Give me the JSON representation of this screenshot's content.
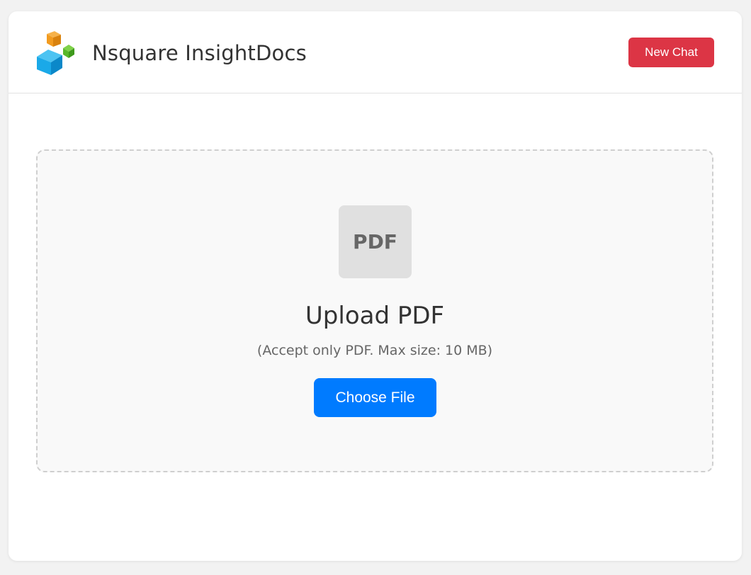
{
  "header": {
    "logo_icon": "stacked-cubes-logo-icon",
    "title": "Nsquare InsightDocs",
    "new_chat_label": "New Chat"
  },
  "upload": {
    "file_icon": "pdf-file-icon",
    "file_icon_label": "PDF",
    "title": "Upload PDF",
    "hint": "(Accept only PDF. Max size: 10 MB)",
    "choose_file_label": "Choose File"
  },
  "colors": {
    "danger": "#dc3545",
    "primary": "#007bff",
    "logo_blue": "#1aa9e8",
    "logo_orange": "#f29b1f",
    "logo_green": "#58b82a"
  }
}
